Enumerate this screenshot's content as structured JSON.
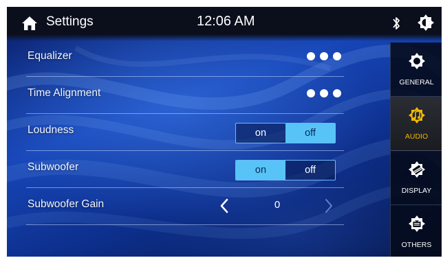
{
  "header": {
    "title": "Settings",
    "time": "12:06 AM",
    "icons": [
      "home-icon",
      "bluetooth-icon",
      "brightness-icon"
    ]
  },
  "settings": {
    "rows": [
      {
        "label": "Equalizer",
        "control": "more"
      },
      {
        "label": "Time Alignment",
        "control": "more"
      },
      {
        "label": "Loudness",
        "control": "toggle",
        "on_label": "on",
        "off_label": "off",
        "selected": "off"
      },
      {
        "label": "Subwoofer",
        "control": "toggle",
        "on_label": "on",
        "off_label": "off",
        "selected": "on"
      },
      {
        "label": "Subwoofer Gain",
        "control": "stepper",
        "value": "0"
      }
    ]
  },
  "sidebar": {
    "items": [
      {
        "label": "GENERAL",
        "icon": "gear-icon",
        "active": false
      },
      {
        "label": "AUDIO",
        "icon": "audio-gear-icon",
        "active": true
      },
      {
        "label": "DISPLAY",
        "icon": "display-icon",
        "active": false
      },
      {
        "label": "OTHERS",
        "icon": "others-icon",
        "active": false
      }
    ]
  },
  "colors": {
    "accent": "#57c3f7",
    "audio_accent": "#f2b800",
    "background": "#1746b8"
  }
}
